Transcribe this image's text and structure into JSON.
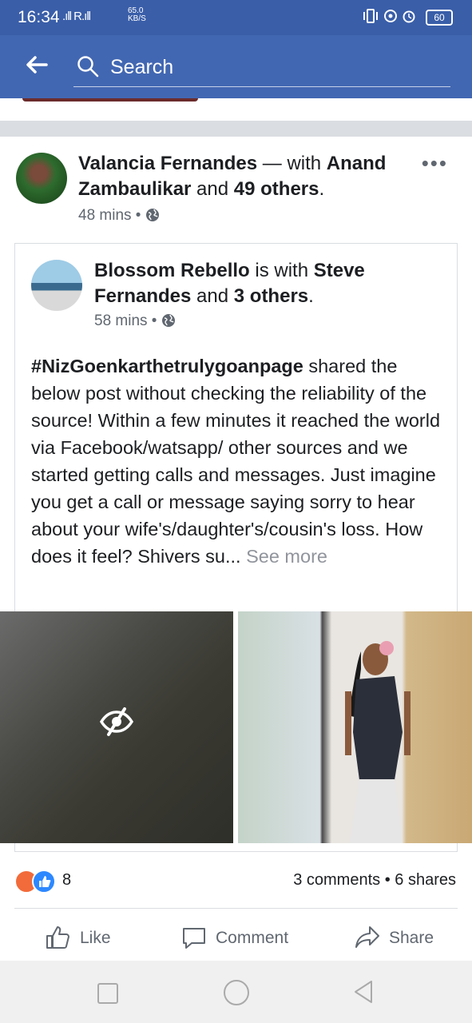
{
  "status_bar": {
    "time": "16:34",
    "signal": ".ıll R.ıll",
    "net_speed_value": "65.0",
    "net_speed_unit": "KB/S",
    "battery": "60"
  },
  "search": {
    "placeholder": "Search"
  },
  "post": {
    "author_name": "Valancia Fernandes",
    "with_text": " — with ",
    "tagged_1": "Anand Zambaulikar",
    "and_text": " and ",
    "tagged_others": "49 others",
    "period": ".",
    "time": "48 mins",
    "dot": " • "
  },
  "shared": {
    "author_name": "Blossom Rebello",
    "is_with_text": " is with ",
    "tagged_1": "Steve Fernandes",
    "and_text": " and ",
    "tagged_others": "3 others",
    "period": ".",
    "time": "58 mins",
    "dot": " • ",
    "hashtag": "#NizGoenkarthetrulygoanpage",
    "body": " shared the below post without checking the reliability of the source! Within a few minutes it reached the world via Facebook/watsapp/ other sources and we started getting calls and messages. Just imagine you get a call or message saying sorry to hear about your wife's/daughter's/cousin's loss. How does it feel? Shivers su...",
    "see_more": " See more"
  },
  "reactions": {
    "count": "8",
    "comments": "3 comments",
    "shares": "6 shares",
    "sep": " • "
  },
  "actions": {
    "like": "Like",
    "comment": "Comment",
    "share": "Share"
  },
  "colors": {
    "app_bar": "#4267b2",
    "status_bar": "#3a5ea8",
    "angry": "#f26b3a",
    "like": "#2d88ff"
  }
}
